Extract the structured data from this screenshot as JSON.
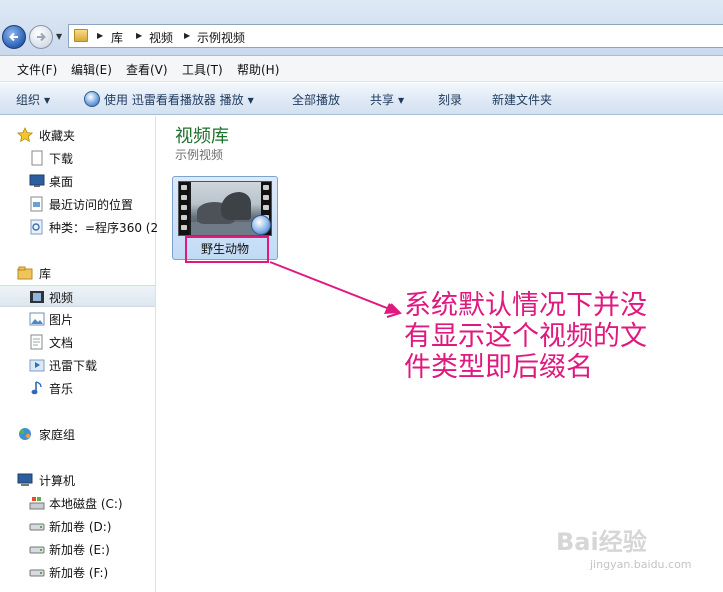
{
  "address": {
    "breadcrumbs": [
      "库",
      "视频",
      "示例视频"
    ]
  },
  "menu": [
    "文件(F)",
    "编辑(E)",
    "查看(V)",
    "工具(T)",
    "帮助(H)"
  ],
  "toolbar": {
    "organize": "组织",
    "play_with": "使用 迅雷看看播放器 播放",
    "play_all": "全部播放",
    "share": "共享",
    "burn": "刻录",
    "new_folder": "新建文件夹"
  },
  "nav": {
    "favorites": {
      "header": "收藏夹",
      "items": [
        "下载",
        "桌面",
        "最近访问的位置",
        "种类：=程序360 (2"
      ]
    },
    "libraries": {
      "header": "库",
      "items": [
        "视频",
        "图片",
        "文档",
        "迅雷下载",
        "音乐"
      ],
      "selected": "视频"
    },
    "homegroup": "家庭组",
    "computer": {
      "header": "计算机",
      "items": [
        "本地磁盘 (C:)",
        "新加卷 (D:)",
        "新加卷 (E:)",
        "新加卷 (F:)"
      ]
    }
  },
  "content": {
    "library_title": "视频库",
    "library_subtitle": "示例视频",
    "files": [
      {
        "name": "野生动物",
        "icon": "video-thumbnail"
      }
    ]
  },
  "annotation": {
    "text": "系统默认情况下并没有显示这个视频的文件类型即后缀名",
    "color": "#e0197f"
  },
  "watermark": {
    "text": "Bai经验",
    "sub": "jingyan.baidu.com"
  },
  "colors": {
    "library_title": "#1f6f2d",
    "selection": "#dde6ef",
    "accent": "#e0197f"
  }
}
